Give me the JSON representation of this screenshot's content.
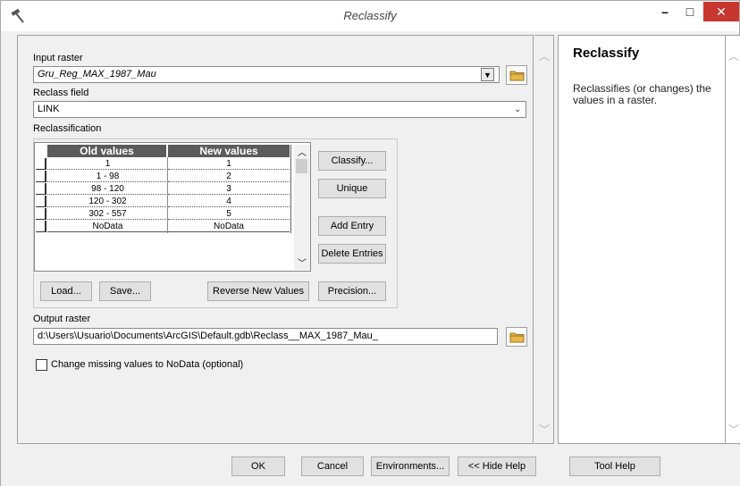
{
  "window": {
    "title": "Reclassify",
    "minimize": "–",
    "maximize": "□",
    "close": "✕"
  },
  "form": {
    "input_raster_label": "Input raster",
    "input_raster_value": "Gru_Reg_MAX_1987_Mau",
    "reclass_field_label": "Reclass field",
    "reclass_field_value": "LINK",
    "reclassification_label": "Reclassification",
    "table": {
      "headers": [
        "Old values",
        "New values"
      ],
      "rows": [
        [
          "1",
          "1"
        ],
        [
          "1 - 98",
          "2"
        ],
        [
          "98 - 120",
          "3"
        ],
        [
          "120 - 302",
          "4"
        ],
        [
          "302 - 557",
          "5"
        ],
        [
          "NoData",
          "NoData"
        ]
      ]
    },
    "buttons": {
      "classify": "Classify...",
      "unique": "Unique",
      "add_entry": "Add Entry",
      "delete_entries": "Delete Entries",
      "load": "Load...",
      "save": "Save...",
      "reverse": "Reverse New Values",
      "precision": "Precision..."
    },
    "output_raster_label": "Output raster",
    "output_raster_value": "d:\\Users\\Usuario\\Documents\\ArcGIS\\Default.gdb\\Reclass__MAX_1987_Mau_",
    "nodata_checkbox_label": "Change missing values to NoData (optional)",
    "nodata_checked": false
  },
  "help": {
    "title": "Reclassify",
    "description": "Reclassifies (or changes) the values in a raster."
  },
  "footer": {
    "ok": "OK",
    "cancel": "Cancel",
    "environments": "Environments...",
    "hide_help": "<< Hide Help",
    "tool_help": "Tool Help"
  },
  "colors": {
    "header_bg": "#5b5b5b",
    "close_btn": "#c7372f",
    "folder_icon": "#e8b84a"
  }
}
